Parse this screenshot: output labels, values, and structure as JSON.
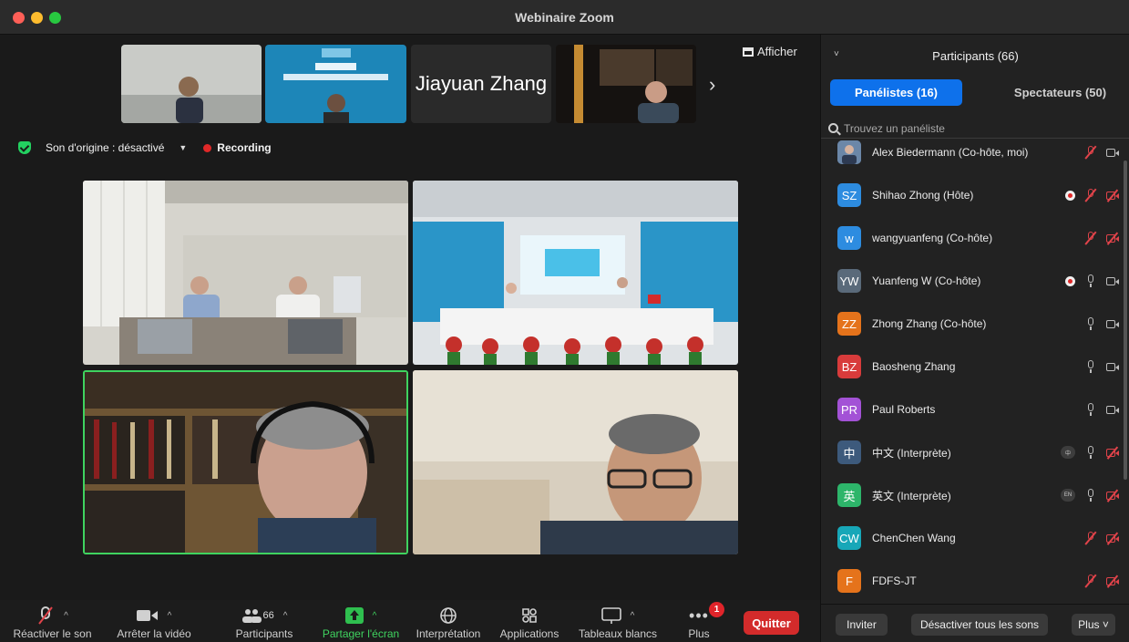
{
  "window": {
    "title": "Webinaire Zoom"
  },
  "strip": {
    "name_tile": "Jiayuan Zhang",
    "afficher_label": "Afficher",
    "next_arrow": "›"
  },
  "status": {
    "audio_label": "Son d'origine : désactivé",
    "recording_label": "Recording"
  },
  "toolbar": {
    "unmute_label": "Réactiver le son",
    "stop_video_label": "Arrêter la vidéo",
    "participants_label": "Participants",
    "participants_count": "66",
    "share_label": "Partager l'écran",
    "interpretation_label": "Interprétation",
    "apps_label": "Applications",
    "whiteboards_label": "Tableaux blancs",
    "more_label": "Plus",
    "more_badge": "1",
    "quit_label": "Quitter"
  },
  "panel": {
    "title": "Participants (66)",
    "tab_panelists": "Panélistes (16)",
    "tab_viewers": "Spectateurs (50)",
    "search_placeholder": "Trouvez un panéliste",
    "invite_label": "Inviter",
    "mute_all_label": "Désactiver tous les sons",
    "more_label": "Plus ˅",
    "participants": [
      {
        "initials": "",
        "name": "Alex Biedermann (Co-hôte, moi)",
        "color": "#5c7da6",
        "rec": false,
        "lang": "",
        "mic": "off",
        "cam": "on"
      },
      {
        "initials": "SZ",
        "name": "Shihao Zhong (Hôte)",
        "color": "#2d8ce0",
        "rec": true,
        "lang": "",
        "mic": "off",
        "cam": "off"
      },
      {
        "initials": "w",
        "name": "wangyuanfeng (Co-hôte)",
        "color": "#2d8ce0",
        "rec": false,
        "lang": "",
        "mic": "off",
        "cam": "off"
      },
      {
        "initials": "YW",
        "name": "Yuanfeng W (Co-hôte)",
        "color": "#5a6a7a",
        "rec": true,
        "lang": "",
        "mic": "on",
        "cam": "on"
      },
      {
        "initials": "ZZ",
        "name": "Zhong Zhang (Co-hôte)",
        "color": "#e5731b",
        "rec": false,
        "lang": "",
        "mic": "on",
        "cam": "on"
      },
      {
        "initials": "BZ",
        "name": "Baosheng Zhang",
        "color": "#d83b3b",
        "rec": false,
        "lang": "",
        "mic": "on",
        "cam": "on"
      },
      {
        "initials": "PR",
        "name": "Paul Roberts",
        "color": "#a352d6",
        "rec": false,
        "lang": "",
        "mic": "on",
        "cam": "on"
      },
      {
        "initials": "中",
        "name": "中文 (Interprète)",
        "color": "#3d5a7c",
        "rec": false,
        "lang": "中",
        "mic": "on",
        "cam": "off"
      },
      {
        "initials": "英",
        "name": "英文 (Interprète)",
        "color": "#2db56a",
        "rec": false,
        "lang": "EN",
        "mic": "on",
        "cam": "off"
      },
      {
        "initials": "CW",
        "name": "ChenChen Wang",
        "color": "#17a7b8",
        "rec": false,
        "lang": "",
        "mic": "off",
        "cam": "off"
      },
      {
        "initials": "F",
        "name": "FDFS-JT",
        "color": "#e5731b",
        "rec": false,
        "lang": "",
        "mic": "off",
        "cam": "off"
      }
    ]
  }
}
